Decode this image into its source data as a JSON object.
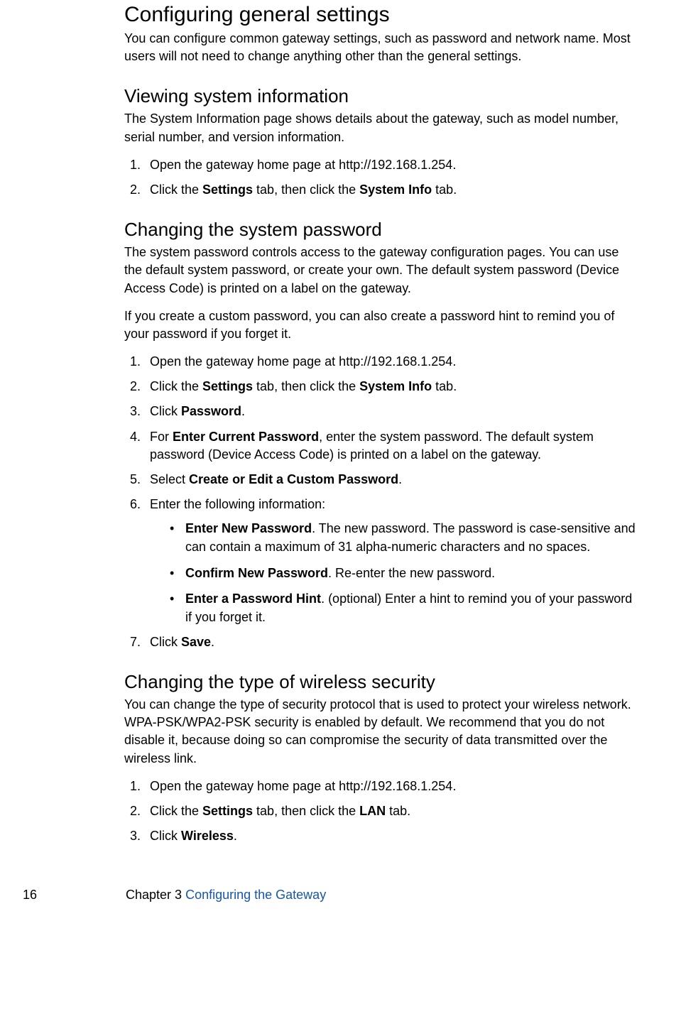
{
  "h1": "Configuring general settings",
  "intro": "You can configure common gateway settings, such as password and network name. Most users will not need to change anything other than the general settings.",
  "s1": {
    "title": "Viewing system information",
    "desc": "The System Information page shows details about the gateway, such as model number, serial number, and version information.",
    "step1": "Open the gateway home page at http://192.168.1.254.",
    "step2_a": "Click the ",
    "step2_b": "Settings",
    "step2_c": " tab, then click the ",
    "step2_d": "System Info",
    "step2_e": " tab."
  },
  "s2": {
    "title": "Changing the system password",
    "desc1": "The system password controls access to the gateway configuration pages. You can use the default system password, or create your own. The default system password (Device Access Code) is printed on a label on the gateway.",
    "desc2": "If you create a custom password, you can also create a password hint to remind you of your password if you forget it.",
    "step1": "Open the gateway home page at http://192.168.1.254.",
    "step2_a": "Click the ",
    "step2_b": "Settings",
    "step2_c": " tab, then click the ",
    "step2_d": "System Info",
    "step2_e": " tab.",
    "step3_a": "Click ",
    "step3_b": "Password",
    "step3_c": ".",
    "step4_a": "For ",
    "step4_b": "Enter Current Password",
    "step4_c": ", enter the system password. The default system password (Device Access Code) is printed on a label on the gateway.",
    "step5_a": "Select ",
    "step5_b": "Create or Edit a Custom Password",
    "step5_c": ".",
    "step6": "Enter the following information:",
    "b1_a": "Enter New Password",
    "b1_b": ". The new password. The password is case-sensitive and can contain a maximum of 31 alpha-numeric characters and no spaces.",
    "b2_a": "Confirm New Password",
    "b2_b": ". Re-enter the new password.",
    "b3_a": "Enter a Password Hint",
    "b3_b": ". (optional) Enter a hint to remind you of your password if you forget it.",
    "step7_a": "Click ",
    "step7_b": "Save",
    "step7_c": "."
  },
  "s3": {
    "title": "Changing the type of wireless security",
    "desc": "You can change the type of security protocol that is used to protect your wireless network. WPA-PSK/WPA2-PSK security is enabled by default. We recommend that you do not disable it, because doing so can compromise the security of data transmitted over the wireless link.",
    "step1": "Open the gateway home page at http://192.168.1.254.",
    "step2_a": "Click the ",
    "step2_b": "Settings",
    "step2_c": " tab, then click the ",
    "step2_d": "LAN",
    "step2_e": " tab.",
    "step3_a": "Click ",
    "step3_b": "Wireless",
    "step3_c": "."
  },
  "footer": {
    "page": "16",
    "chapter": "Chapter 3  ",
    "title": "Configuring the Gateway"
  }
}
